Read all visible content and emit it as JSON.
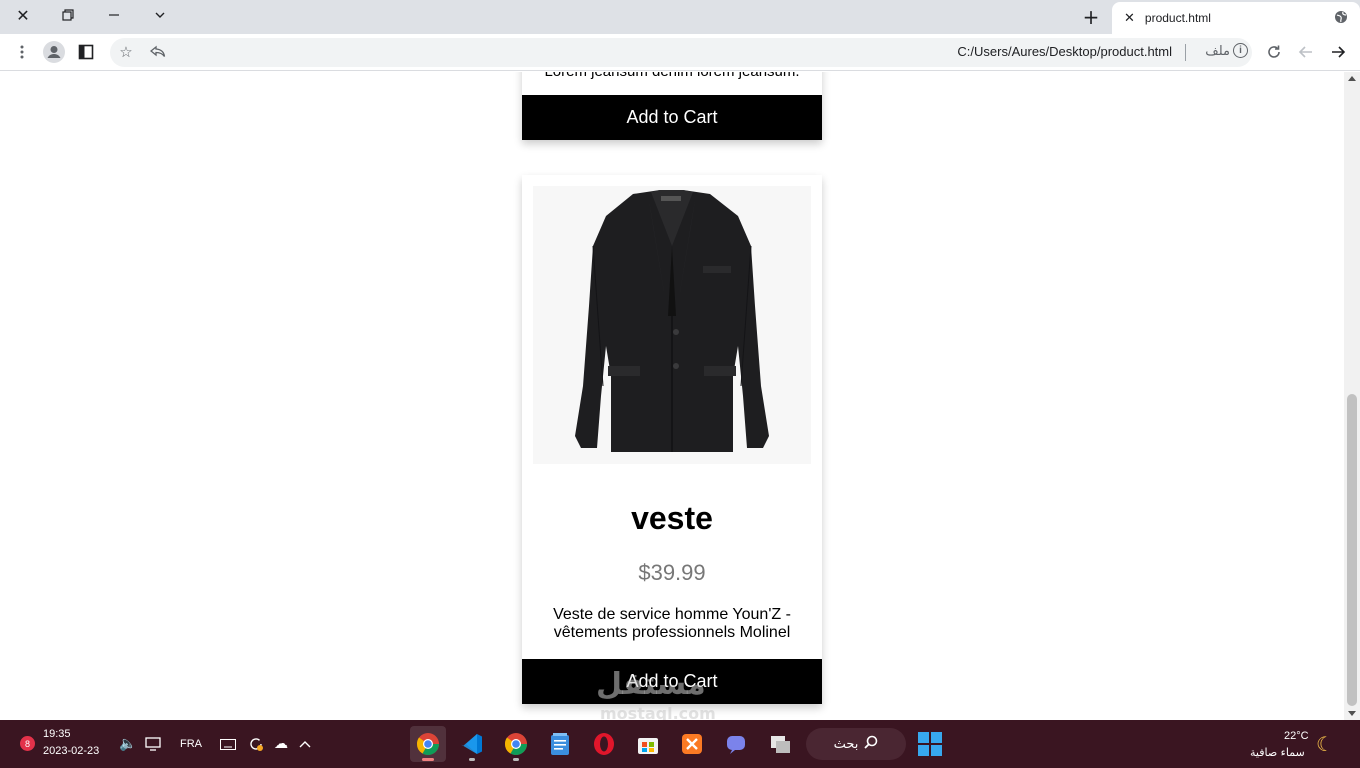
{
  "browser": {
    "tab_title": "product.html",
    "url": "C:/Users/Aures/Desktop/product.html",
    "file_label": "ملف"
  },
  "page": {
    "top_card": {
      "description": "Lorem jeansum denim lorem jeansum.",
      "button_label": "Add to Cart"
    },
    "product": {
      "name": "veste",
      "price": "$39.99",
      "description": "Veste de service homme Youn'Z - vêtements professionnels Molinel",
      "button_label": "Add to Cart"
    },
    "watermark": "مستقل",
    "watermark_sub": "mostaql.com"
  },
  "taskbar": {
    "notification_count": "8",
    "time": "19:35",
    "date": "2023-02-23",
    "language": "FRA",
    "search_label": "بحث",
    "temperature": "22°C",
    "weather": "سماء صافية"
  },
  "colors": {
    "button_bg": "#000000",
    "price": "#777777",
    "taskbar_bg": "#3a1521"
  }
}
